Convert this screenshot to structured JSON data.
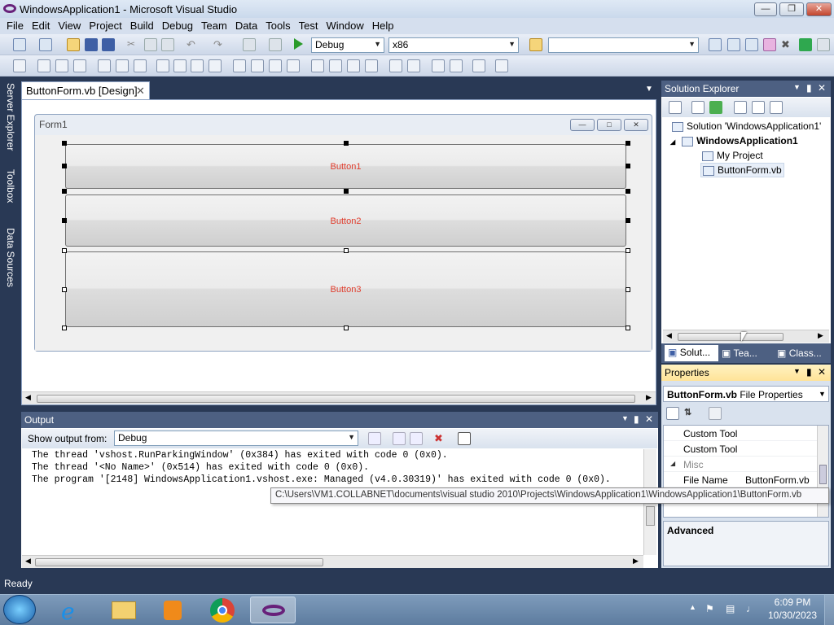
{
  "window": {
    "title": "WindowsApplication1 - Microsoft Visual Studio"
  },
  "menu": [
    "File",
    "Edit",
    "View",
    "Project",
    "Build",
    "Debug",
    "Team",
    "Data",
    "Tools",
    "Test",
    "Window",
    "Help"
  ],
  "toolbar": {
    "config": "Debug",
    "platform": "x86",
    "search_value": ""
  },
  "left_tabs": [
    "Server Explorer",
    "Toolbox",
    "Data Sources"
  ],
  "doc_tab": {
    "label": "ButtonForm.vb [Design]"
  },
  "designer": {
    "form_title": "Form1",
    "buttons": [
      "Button1",
      "Button2",
      "Button3"
    ]
  },
  "solution_explorer": {
    "title": "Solution Explorer",
    "items": [
      "Solution 'WindowsApplication1'",
      "WindowsApplication1",
      "My Project",
      "ButtonForm.vb"
    ],
    "bottom_tabs": [
      "Solut...",
      "Tea...",
      "Class..."
    ]
  },
  "properties": {
    "title": "Properties",
    "object": "ButtonForm.vb",
    "object_type": "File Properties",
    "rows": [
      {
        "name": "Custom Tool",
        "value": ""
      },
      {
        "name": "Custom Tool",
        "value": ""
      },
      {
        "name": "Misc",
        "value": ""
      },
      {
        "name": "File Name",
        "value": "ButtonForm.vb"
      }
    ],
    "description_title": "Advanced"
  },
  "output": {
    "title": "Output",
    "show_from_label": "Show output from:",
    "show_from_value": "Debug",
    "lines": [
      "The thread 'vshost.RunParkingWindow' (0x384) has exited with code 0 (0x0).",
      "The thread '<No Name>' (0x514) has exited with code 0 (0x0).",
      "The program '[2148] WindowsApplication1.vshost.exe: Managed (v4.0.30319)' has exited with code 0 (0x0)."
    ]
  },
  "tooltip": "C:\\Users\\VM1.COLLABNET\\documents\\visual studio 2010\\Projects\\WindowsApplication1\\WindowsApplication1\\ButtonForm.vb",
  "status": {
    "text": "Ready"
  },
  "taskbar": {
    "time": "6:09 PM",
    "date": "10/30/2023"
  },
  "colors": {
    "accent": "#293955",
    "button_text": "#e03c2c",
    "active_header": "#ffe398"
  }
}
